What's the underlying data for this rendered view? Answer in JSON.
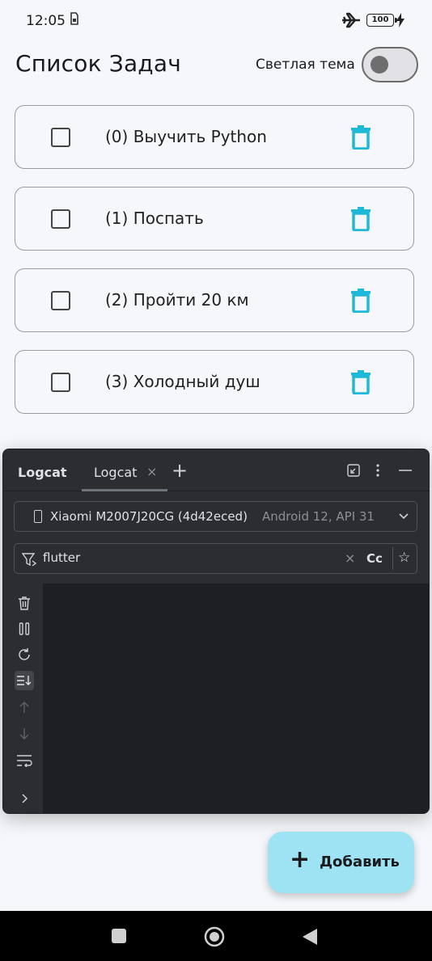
{
  "status_bar": {
    "time": "12:05",
    "battery": "100"
  },
  "app_bar": {
    "title": "Список Задач",
    "theme_label": "Светлая тема",
    "theme_switch_on": false
  },
  "tasks": [
    {
      "label": "(0) Выучить Python",
      "checked": false
    },
    {
      "label": "(1) Поспать",
      "checked": false
    },
    {
      "label": "(2) Пройти 20 км",
      "checked": false
    },
    {
      "label": "(3) Холодный душ",
      "checked": false
    }
  ],
  "logcat": {
    "title": "Logcat",
    "tab_label": "Logcat",
    "tab_close": "×",
    "add_tab": "+",
    "device_name": "Xiaomi M2007J20CG (4d42eced)",
    "device_api": "Android 12, API 31",
    "filter_text": "flutter",
    "filter_clear": "×",
    "match_case": "Cc",
    "favorite": "☆"
  },
  "fab": {
    "icon": "+",
    "label": "Добавить"
  },
  "colors": {
    "background": "#f5f7fb",
    "accent_trash": "#1fb8d8",
    "fab": "#9ee3f3",
    "logcat_panel": "#2b2d30",
    "logcat_body": "#1e1f22"
  }
}
